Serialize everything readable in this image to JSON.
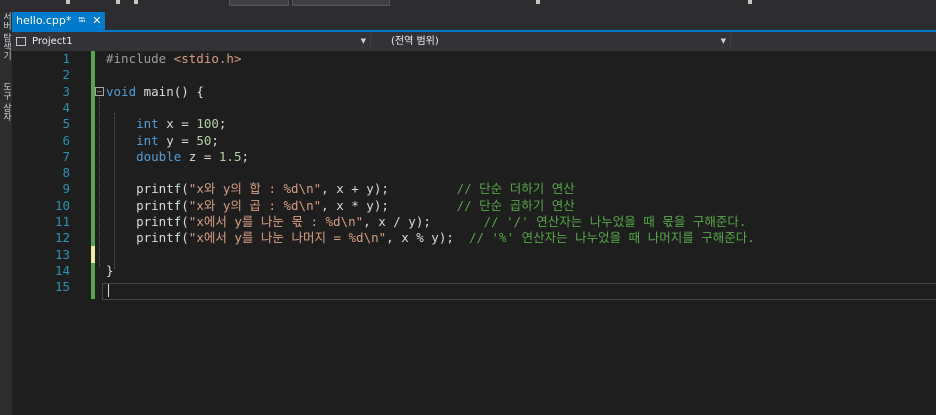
{
  "left_panel": {
    "labels": [
      "서버 탐색기",
      "도구 상자"
    ]
  },
  "tab": {
    "filename": "hello.cpp*",
    "pin_icon": "pin-icon",
    "close_icon": "close-icon"
  },
  "navbar": {
    "project": "Project1",
    "scope": "(전역 범위)"
  },
  "editor": {
    "line_numbers": [
      "1",
      "2",
      "3",
      "4",
      "5",
      "6",
      "7",
      "8",
      "9",
      "10",
      "11",
      "12",
      "13",
      "14",
      "15"
    ],
    "lines": [
      [
        {
          "t": "#include ",
          "c": "pp"
        },
        {
          "t": "<stdio.h>",
          "c": "hdr"
        }
      ],
      [],
      [
        {
          "t": "void",
          "c": "kw"
        },
        {
          "t": " main() {",
          "c": ""
        }
      ],
      [],
      [
        {
          "t": "    ",
          "c": ""
        },
        {
          "t": "int",
          "c": "kw"
        },
        {
          "t": " x = ",
          "c": ""
        },
        {
          "t": "100",
          "c": "num"
        },
        {
          "t": ";",
          "c": ""
        }
      ],
      [
        {
          "t": "    ",
          "c": ""
        },
        {
          "t": "int",
          "c": "kw"
        },
        {
          "t": " y = ",
          "c": ""
        },
        {
          "t": "50",
          "c": "num"
        },
        {
          "t": ";",
          "c": ""
        }
      ],
      [
        {
          "t": "    ",
          "c": ""
        },
        {
          "t": "double",
          "c": "kw"
        },
        {
          "t": " z = ",
          "c": ""
        },
        {
          "t": "1.5",
          "c": "num"
        },
        {
          "t": ";",
          "c": ""
        }
      ],
      [],
      [
        {
          "t": "    printf(",
          "c": ""
        },
        {
          "t": "\"x와 y의 합 : %d\\n\"",
          "c": "str"
        },
        {
          "t": ", x + y);         ",
          "c": ""
        },
        {
          "t": "// 단순 더하기 연산",
          "c": "cm"
        }
      ],
      [
        {
          "t": "    printf(",
          "c": ""
        },
        {
          "t": "\"x와 y의 곱 : %d\\n\"",
          "c": "str"
        },
        {
          "t": ", x * y);         ",
          "c": ""
        },
        {
          "t": "// 단순 곱하기 연산",
          "c": "cm"
        }
      ],
      [
        {
          "t": "    printf(",
          "c": ""
        },
        {
          "t": "\"x에서 y를 나눈 몫 : %d\\n\"",
          "c": "str"
        },
        {
          "t": ", x / y);       ",
          "c": ""
        },
        {
          "t": "// '/' 연산자는 나누었을 때 몫을 구해준다.",
          "c": "cm"
        }
      ],
      [
        {
          "t": "    printf(",
          "c": ""
        },
        {
          "t": "\"x에서 y를 나눈 나머지 = %d\\n\"",
          "c": "str"
        },
        {
          "t": ", x % y);  ",
          "c": ""
        },
        {
          "t": "// '%' 연산자는 나누었을 때 나머지를 구해준다.",
          "c": "cm"
        }
      ],
      [],
      [
        {
          "t": "}",
          "c": ""
        }
      ],
      []
    ]
  }
}
